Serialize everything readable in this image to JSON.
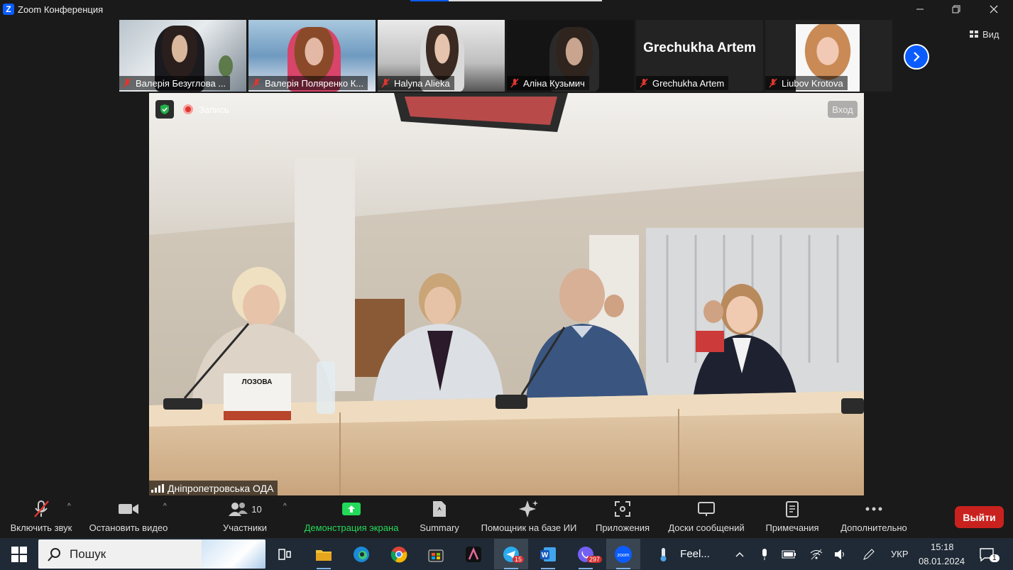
{
  "window": {
    "title": "Zoom Конференция",
    "controls": [
      "minimize",
      "restore",
      "close"
    ]
  },
  "loading_progress": 0.2,
  "gallery": {
    "participants": [
      {
        "name": "Валерія Безуглова ..."
      },
      {
        "name": "Валерія Поляренко К..."
      },
      {
        "name": "Halyna Alieka"
      },
      {
        "name": "Аліна Кузьмич"
      },
      {
        "name": "Grechukha Artem",
        "display_text": "Grechukha Artem"
      },
      {
        "name": "Liubov Krotova"
      }
    ],
    "view_label": "Вид"
  },
  "main": {
    "recording_label": "Запись",
    "login_label": "Вход",
    "speaker_name": "Дніпропетровська ОДА",
    "nameplate_text": "ЛОЗОВА"
  },
  "toolbar": {
    "unmute": "Включить звук",
    "stop_video": "Остановить видео",
    "participants": "Участники",
    "participants_count": "10",
    "share_screen": "Демонстрация экрана",
    "summary": "Summary",
    "ai_assistant": "Помощник на базе ИИ",
    "apps": "Приложения",
    "whiteboards": "Доски сообщений",
    "notes": "Примечания",
    "more": "Дополнительно",
    "leave": "Выйти"
  },
  "taskbar": {
    "search_placeholder": "Пошук",
    "telegram_badge": "15",
    "viber_badge": "297",
    "weather_text": "Feel...",
    "language": "УКР",
    "time": "15:18",
    "date": "08.01.2024",
    "notification_count": "1"
  },
  "colors": {
    "zoom_blue": "#0b5cff",
    "share_green": "#23d959",
    "leave_red": "#c9221e",
    "mic_off_red": "#e0362f"
  }
}
